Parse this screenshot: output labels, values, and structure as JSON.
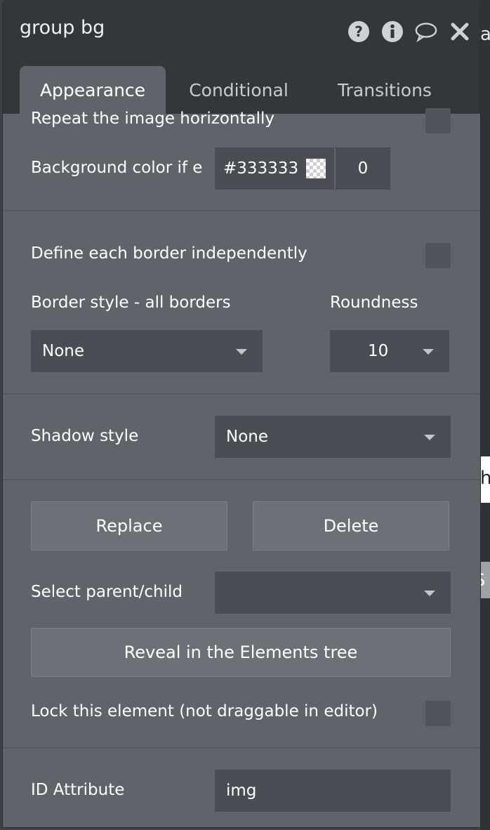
{
  "panel": {
    "title": "group bg",
    "icons": [
      "help-icon",
      "info-icon",
      "comment-icon",
      "close-icon"
    ]
  },
  "tabs": [
    {
      "label": "Appearance",
      "active": true
    },
    {
      "label": "Conditional",
      "active": false
    },
    {
      "label": "Transitions",
      "active": false
    }
  ],
  "appearance": {
    "repeat_horizontal_label": "Repeat the image horizontally",
    "bg_color_label": "Background color if e",
    "bg_color_value": "#333333",
    "bg_opacity_value": "0",
    "define_border_label": "Define each border independently",
    "border_style_label": "Border style - all borders",
    "border_style_value": "None",
    "roundness_label": "Roundness",
    "roundness_value": "10",
    "shadow_style_label": "Shadow style",
    "shadow_style_value": "None",
    "replace_label": "Replace",
    "delete_label": "Delete",
    "select_parent_label": "Select parent/child",
    "select_parent_value": "",
    "reveal_label": "Reveal in the Elements tree",
    "lock_label": "Lock this element (not draggable in editor)",
    "id_attribute_label": "ID Attribute",
    "id_attribute_value": "img"
  },
  "background_fragments": {
    "top_char": "a",
    "mid_char": "h",
    "help_bubble_mark": "?",
    "help_bubble_text": "S"
  },
  "colors": {
    "panel_bg": "#5f646b",
    "titlebar_bg": "#33373b",
    "field_bg": "#4a4e54"
  }
}
